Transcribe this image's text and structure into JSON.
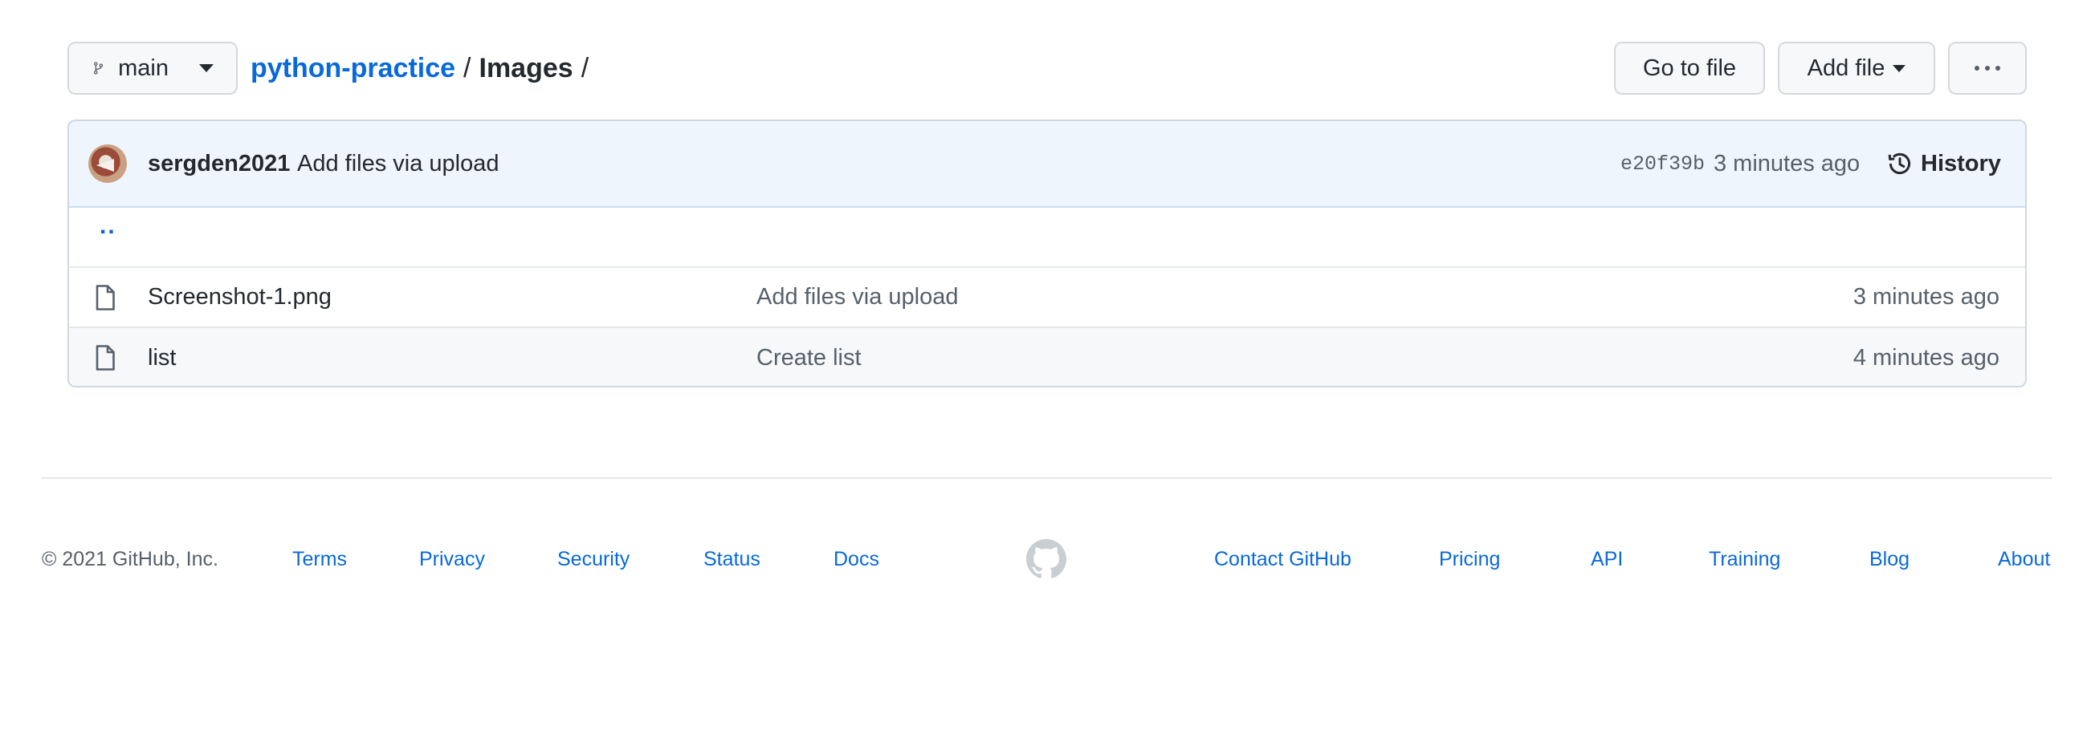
{
  "toolbar": {
    "branch_label": "main",
    "go_to_file_label": "Go to file",
    "add_file_label": "Add file",
    "more_icon": "kebab-horizontal-icon"
  },
  "breadcrumb": {
    "repo": "python-practice",
    "separator": "/",
    "folder": "Images",
    "trailing_separator": "/"
  },
  "latest_commit": {
    "author": "sergden2021",
    "message": "Add files via upload",
    "sha": "e20f39b",
    "time": "3 minutes ago",
    "history_label": "History"
  },
  "files": {
    "parent_link": "..",
    "rows": [
      {
        "name": "Screenshot-1.png",
        "message": "Add files via upload",
        "time": "3 minutes ago",
        "icon": "file-icon"
      },
      {
        "name": "list",
        "message": "Create list",
        "time": "4 minutes ago",
        "icon": "file-icon"
      }
    ]
  },
  "footer": {
    "copyright": "© 2021 GitHub, Inc.",
    "left_links": [
      "Terms",
      "Privacy",
      "Security",
      "Status",
      "Docs"
    ],
    "right_links": [
      "Contact GitHub",
      "Pricing",
      "API",
      "Training",
      "Blog",
      "About"
    ]
  },
  "colors": {
    "link": "#0969da",
    "commit_bar_bg": "#eef5fd",
    "border": "#d0d7de",
    "muted_text": "#57606a"
  }
}
